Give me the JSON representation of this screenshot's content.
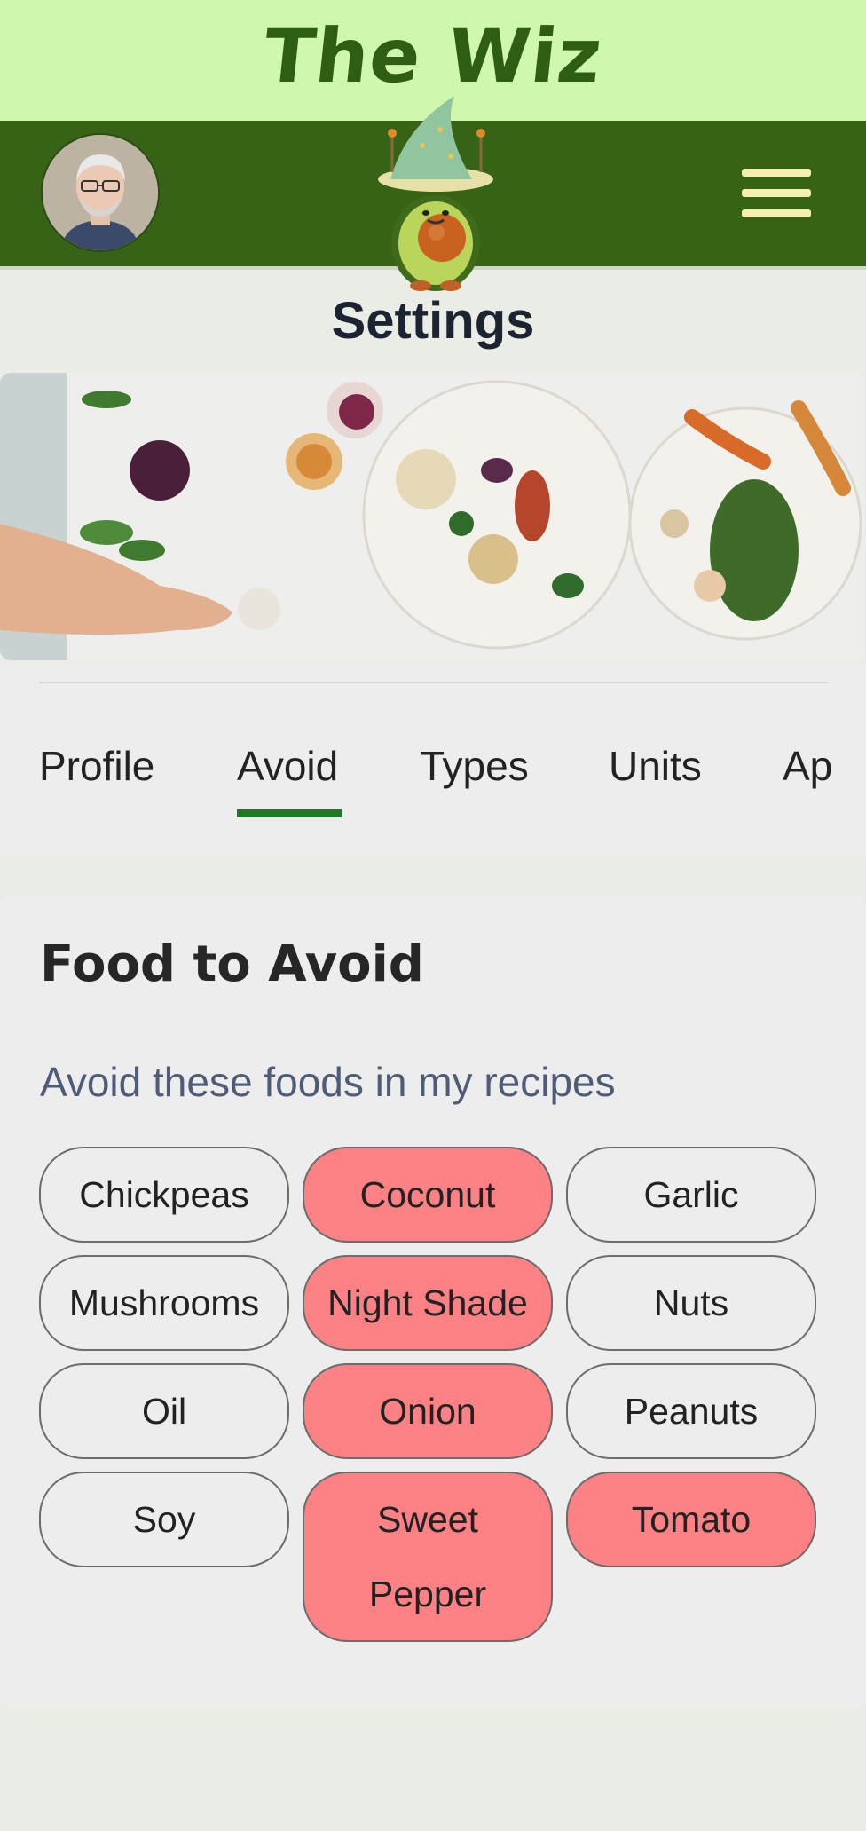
{
  "app": {
    "title": "The Wiz"
  },
  "header": {
    "avatar_icon": "user-avatar",
    "mascot_icon": "avocado-wizard-mascot",
    "menu_icon": "hamburger-menu-icon"
  },
  "page": {
    "title": "Settings"
  },
  "tabs": [
    {
      "label": "Profile",
      "active": false
    },
    {
      "label": "Avoid",
      "active": true
    },
    {
      "label": "Types",
      "active": false
    },
    {
      "label": "Units",
      "active": false
    },
    {
      "label": "Ap",
      "active": false
    }
  ],
  "avoid": {
    "title": "Food to Avoid",
    "subtitle": "Avoid these foods in my recipes",
    "foods": [
      {
        "label": "Chickpeas",
        "selected": false
      },
      {
        "label": "Coconut",
        "selected": true
      },
      {
        "label": "Garlic",
        "selected": false
      },
      {
        "label": "Mushrooms",
        "selected": false
      },
      {
        "label": "Night Shade",
        "selected": true
      },
      {
        "label": "Nuts",
        "selected": false
      },
      {
        "label": "Oil",
        "selected": false
      },
      {
        "label": "Onion",
        "selected": true
      },
      {
        "label": "Peanuts",
        "selected": false
      },
      {
        "label": "Soy",
        "selected": false
      },
      {
        "label": "Sweet Pepper",
        "selected": true
      },
      {
        "label": "Tomato",
        "selected": true
      }
    ]
  },
  "colors": {
    "title_band": "#cff7ad",
    "nav_bar": "#376317",
    "active_tab": "#1e7a25",
    "chip_selected": "#fb8184"
  }
}
